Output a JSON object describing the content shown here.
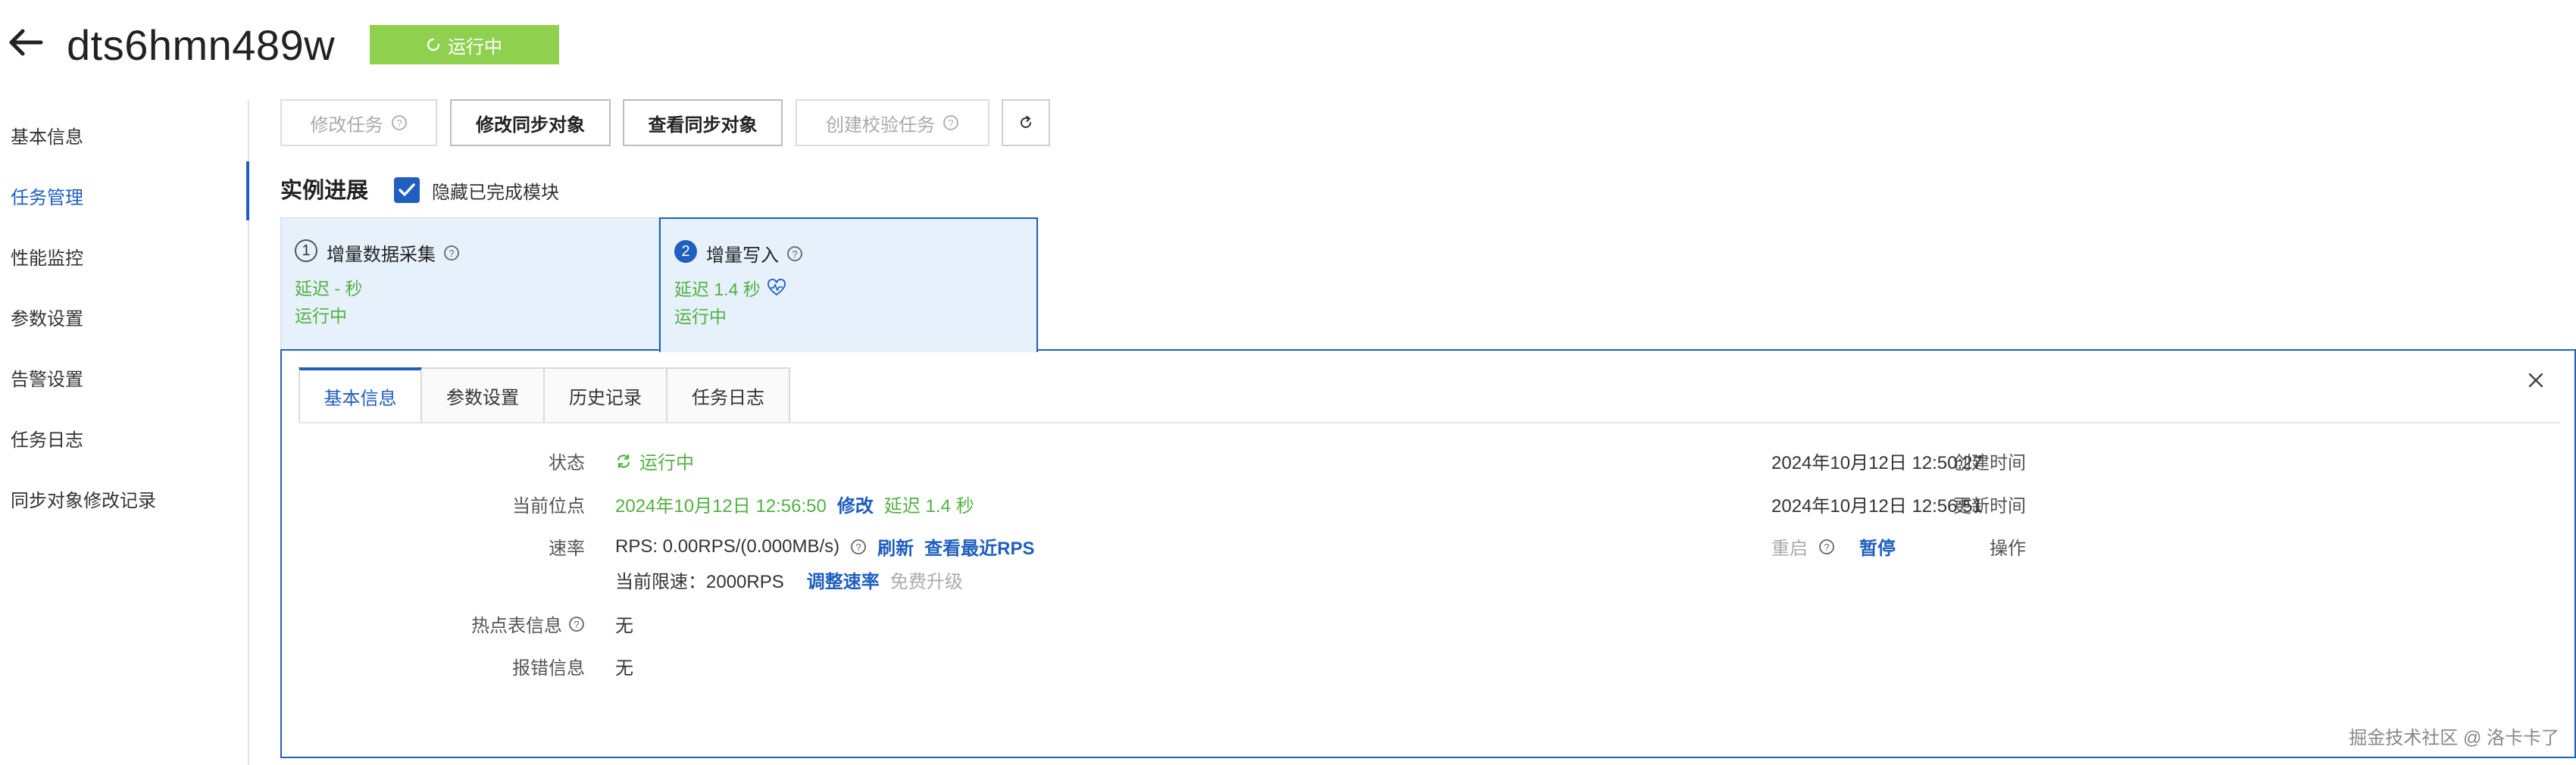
{
  "header": {
    "title": "dts6hmn489w",
    "status_label": "运行中"
  },
  "sidebar": {
    "items": [
      {
        "label": "基本信息"
      },
      {
        "label": "任务管理"
      },
      {
        "label": "性能监控"
      },
      {
        "label": "参数设置"
      },
      {
        "label": "告警设置"
      },
      {
        "label": "任务日志"
      },
      {
        "label": "同步对象修改记录"
      }
    ],
    "active": "任务管理"
  },
  "toolbar": {
    "modify_task": "修改任务",
    "modify_sync_objects": "修改同步对象",
    "view_sync_objects": "查看同步对象",
    "create_verify_task": "创建校验任务"
  },
  "progress": {
    "title": "实例进展",
    "hide_completed_label": "隐藏已完成模块",
    "hide_completed_checked": true,
    "modules": [
      {
        "step": "1",
        "name": "增量数据采集",
        "delay": "延迟 - 秒",
        "status": "运行中"
      },
      {
        "step": "2",
        "name": "增量写入",
        "delay": "延迟 1.4 秒",
        "status": "运行中"
      }
    ]
  },
  "detail": {
    "tabs": [
      "基本信息",
      "参数设置",
      "历史记录",
      "任务日志"
    ],
    "active_tab": "基本信息",
    "status_label": "状态",
    "status_value": "运行中",
    "position_label": "当前位点",
    "position_value": "2024年10月12日 12:56:50",
    "position_modify": "修改",
    "position_delay": "延迟 1.4 秒",
    "rate_label": "速率",
    "rate_value": "RPS: 0.00RPS/(0.000MB/s)",
    "rate_refresh": "刷新",
    "rate_view_recent": "查看最近RPS",
    "limit_value": "当前限速：2000RPS",
    "limit_adjust": "调整速率",
    "limit_upgrade": "免费升级",
    "hot_table_label": "热点表信息",
    "hot_table_value": "无",
    "error_label": "报错信息",
    "error_value": "无",
    "created_label": "创建时间",
    "created_value": "2024年10月12日 12:50:27",
    "updated_label": "更新时间",
    "updated_value": "2024年10月12日 12:56:51",
    "ops_label": "操作",
    "ops_restart": "重启",
    "ops_pause": "暂停"
  },
  "watermark": "掘金技术社区 @ 洛卡卡了",
  "colors": {
    "primary": "#1f5fbf",
    "running_green": "#52b043",
    "status_pill": "#8fd14f",
    "card_bg": "#e6f1fb"
  },
  "icons": [
    "back-arrow-icon",
    "spinner-icon",
    "help-icon",
    "refresh-icon",
    "check-icon",
    "heartbeat-icon",
    "sync-icon",
    "close-icon"
  ]
}
